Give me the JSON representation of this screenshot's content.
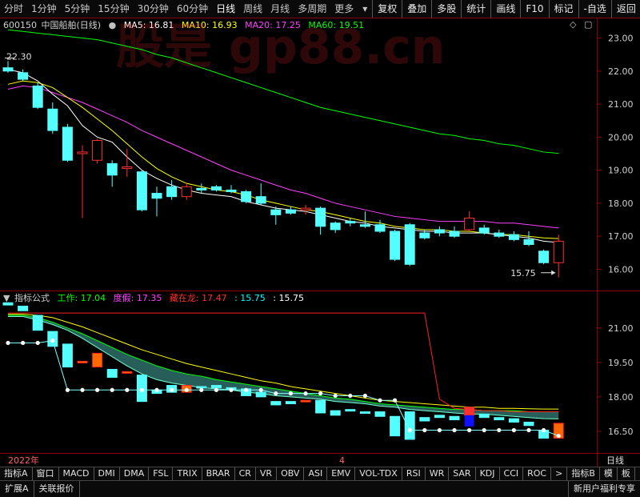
{
  "toolbar": {
    "period_tabs": [
      "分时",
      "1分钟",
      "5分钟",
      "15分钟",
      "30分钟",
      "60分钟",
      "日线",
      "周线",
      "月线",
      "多周期",
      "更多"
    ],
    "active_tab": "日线",
    "right_buttons": [
      "复权",
      "叠加",
      "多股",
      "统计",
      "画线",
      "F10",
      "标记",
      "-自选",
      "返回"
    ]
  },
  "watermark": "股是 gp88.cn",
  "main_legend": {
    "code": "600150",
    "name": "中国船舶(日线)",
    "ma5": "MA5: 16.81",
    "ma10": "MA10: 16.93",
    "ma20": "MA20: 17.25",
    "ma60": "MA60: 19.51",
    "colors": {
      "ma5": "#ffffff",
      "ma10": "#ffff00",
      "ma20": "#ff40ff",
      "ma60": "#00ff00"
    }
  },
  "main_labels": {
    "high_label": "22.30",
    "low_label": "15.75"
  },
  "main_axis": {
    "ticks": [
      "23.00",
      "22.00",
      "21.00",
      "20.00",
      "19.00",
      "18.00",
      "17.00",
      "16.00"
    ]
  },
  "ind_legend": {
    "title": "指标公式",
    "gz": "工作: 17.04",
    "dj": "度假: 17.35",
    "qz": "藏在龙: 17.47",
    "v1": ": 15.75",
    "v2": ": 15.75"
  },
  "ind_axis": {
    "ticks": [
      "21.00",
      "19.50",
      "18.00",
      "16.50"
    ]
  },
  "date_bar": {
    "year": "2022年",
    "month": "4",
    "period": "日线"
  },
  "indicator_tabs": [
    "指标A",
    "窗口",
    "MACD",
    "DMI",
    "DMA",
    "FSL",
    "TRIX",
    "BRAR",
    "CR",
    "VR",
    "OBV",
    "ASI",
    "EMV",
    "VOL-TDX",
    "RSI",
    "WR",
    "SAR",
    "KDJ",
    "CCI",
    "ROC",
    ">",
    "指标B",
    "模",
    "板"
  ],
  "bottom_bar": {
    "left": [
      "扩展A",
      "关联报价"
    ],
    "right": "新用户福利专享"
  },
  "chart_data": {
    "type": "candlestick",
    "candles": [
      {
        "o": 22.1,
        "c": 22.0,
        "h": 22.3,
        "l": 21.95
      },
      {
        "o": 21.95,
        "c": 21.75,
        "h": 22.05,
        "l": 21.7
      },
      {
        "o": 21.55,
        "c": 20.9,
        "h": 21.65,
        "l": 20.85
      },
      {
        "o": 20.85,
        "c": 20.2,
        "h": 21.05,
        "l": 20.1
      },
      {
        "o": 20.3,
        "c": 19.3,
        "h": 20.4,
        "l": 19.25
      },
      {
        "o": 19.5,
        "c": 19.55,
        "h": 19.75,
        "l": 17.55
      },
      {
        "o": 19.3,
        "c": 19.9,
        "h": 19.95,
        "l": 19.2
      },
      {
        "o": 19.2,
        "c": 18.85,
        "h": 19.3,
        "l": 18.5
      },
      {
        "o": 19.05,
        "c": 19.1,
        "h": 19.65,
        "l": 18.8
      },
      {
        "o": 18.95,
        "c": 17.8,
        "h": 19.0,
        "l": 17.75
      },
      {
        "o": 18.3,
        "c": 18.15,
        "h": 18.5,
        "l": 17.6
      },
      {
        "o": 18.5,
        "c": 18.2,
        "h": 18.7,
        "l": 18.1
      },
      {
        "o": 18.2,
        "c": 18.5,
        "h": 18.6,
        "l": 18.1
      },
      {
        "o": 18.45,
        "c": 18.4,
        "h": 18.6,
        "l": 18.3
      },
      {
        "o": 18.5,
        "c": 18.4,
        "h": 18.55,
        "l": 18.35
      },
      {
        "o": 18.4,
        "c": 18.35,
        "h": 18.55,
        "l": 18.3
      },
      {
        "o": 18.35,
        "c": 18.05,
        "h": 18.4,
        "l": 18.0
      },
      {
        "o": 18.2,
        "c": 18.0,
        "h": 18.6,
        "l": 17.95
      },
      {
        "o": 17.8,
        "c": 17.65,
        "h": 17.9,
        "l": 17.35
      },
      {
        "o": 17.8,
        "c": 17.7,
        "h": 17.9,
        "l": 17.65
      },
      {
        "o": 17.8,
        "c": 17.85,
        "h": 17.95,
        "l": 17.65
      },
      {
        "o": 17.85,
        "c": 17.3,
        "h": 17.9,
        "l": 17.05
      },
      {
        "o": 17.4,
        "c": 17.2,
        "h": 17.45,
        "l": 17.1
      },
      {
        "o": 17.45,
        "c": 17.4,
        "h": 17.55,
        "l": 17.3
      },
      {
        "o": 17.35,
        "c": 17.3,
        "h": 17.75,
        "l": 17.25
      },
      {
        "o": 17.35,
        "c": 17.15,
        "h": 17.5,
        "l": 17.1
      },
      {
        "o": 17.15,
        "c": 16.3,
        "h": 17.2,
        "l": 16.25
      },
      {
        "o": 17.35,
        "c": 16.15,
        "h": 17.4,
        "l": 16.1
      },
      {
        "o": 17.1,
        "c": 16.95,
        "h": 17.2,
        "l": 16.9
      },
      {
        "o": 17.2,
        "c": 17.1,
        "h": 17.3,
        "l": 17.0
      },
      {
        "o": 17.15,
        "c": 17.0,
        "h": 17.3,
        "l": 16.95
      },
      {
        "o": 17.2,
        "c": 17.55,
        "h": 17.75,
        "l": 17.15
      },
      {
        "o": 17.25,
        "c": 17.1,
        "h": 17.35,
        "l": 17.05
      },
      {
        "o": 17.1,
        "c": 17.0,
        "h": 17.2,
        "l": 16.95
      },
      {
        "o": 17.05,
        "c": 16.9,
        "h": 17.15,
        "l": 16.85
      },
      {
        "o": 16.9,
        "c": 16.75,
        "h": 17.15,
        "l": 16.7
      },
      {
        "o": 16.55,
        "c": 16.2,
        "h": 16.6,
        "l": 16.15
      },
      {
        "o": 16.2,
        "c": 16.85,
        "h": 17.05,
        "l": 15.75
      }
    ],
    "ma5": [
      22.05,
      21.95,
      21.7,
      21.3,
      20.95,
      20.35,
      20.0,
      19.85,
      19.4,
      19.0,
      18.75,
      18.55,
      18.4,
      18.3,
      18.25,
      18.2,
      18.05,
      17.95,
      17.85,
      17.8,
      17.75,
      17.65,
      17.55,
      17.45,
      17.4,
      17.3,
      17.25,
      17.2,
      17.15,
      17.15,
      17.1,
      17.1,
      17.1,
      17.05,
      17.0,
      16.95,
      16.85,
      16.81
    ],
    "ma10": [
      21.6,
      21.7,
      21.65,
      21.5,
      21.2,
      20.9,
      20.55,
      20.2,
      19.8,
      19.4,
      19.05,
      18.8,
      18.6,
      18.5,
      18.4,
      18.35,
      18.25,
      18.1,
      18.0,
      17.9,
      17.8,
      17.75,
      17.65,
      17.55,
      17.45,
      17.4,
      17.3,
      17.25,
      17.2,
      17.2,
      17.15,
      17.15,
      17.1,
      17.05,
      17.05,
      17.0,
      16.95,
      16.93
    ],
    "ma20": [
      21.45,
      21.55,
      21.5,
      21.35,
      21.2,
      21.05,
      20.85,
      20.65,
      20.45,
      20.2,
      20.0,
      19.8,
      19.6,
      19.4,
      19.2,
      19.0,
      18.85,
      18.7,
      18.55,
      18.4,
      18.3,
      18.15,
      18.0,
      17.9,
      17.8,
      17.7,
      17.6,
      17.55,
      17.5,
      17.45,
      17.45,
      17.45,
      17.45,
      17.4,
      17.4,
      17.35,
      17.3,
      17.25
    ],
    "ma60": [
      23.25,
      23.2,
      23.15,
      23.1,
      23.05,
      23.0,
      22.95,
      22.85,
      22.75,
      22.65,
      22.5,
      22.4,
      22.25,
      22.1,
      21.95,
      21.8,
      21.65,
      21.5,
      21.35,
      21.2,
      21.05,
      20.9,
      20.8,
      20.7,
      20.6,
      20.5,
      20.4,
      20.3,
      20.2,
      20.1,
      20.05,
      19.95,
      19.9,
      19.8,
      19.75,
      19.65,
      19.55,
      19.51
    ],
    "main_ylim": [
      15.6,
      23.4
    ],
    "ind_ylim": [
      15.8,
      21.9
    ],
    "indicator": {
      "support_dots": [
        20.35,
        20.35,
        20.35,
        20.45,
        18.3,
        18.3,
        18.3,
        18.3,
        18.3,
        18.3,
        18.3,
        18.3,
        18.3,
        18.3,
        18.3,
        18.3,
        18.3,
        18.3,
        18.15,
        18.15,
        18.15,
        18.15,
        18.05,
        18.05,
        18.05,
        17.85,
        17.85,
        16.55,
        16.55,
        16.55,
        16.55,
        16.55,
        16.55,
        16.55,
        16.55,
        16.55,
        16.55,
        16.3
      ],
      "red_step": [
        21.65,
        21.65,
        21.65,
        21.65,
        21.65,
        21.65,
        21.65,
        21.65,
        21.65,
        21.65,
        21.65,
        21.65,
        21.65,
        21.65,
        21.65,
        21.65,
        21.65,
        21.65,
        21.65,
        21.65,
        21.65,
        21.65,
        21.65,
        21.65,
        21.65,
        21.65,
        21.65,
        21.65,
        21.65,
        17.9,
        17.5,
        17.45,
        17.4,
        17.4,
        17.35,
        17.35,
        17.35,
        17.35
      ],
      "gz": [
        21.5,
        21.5,
        21.35,
        21.15,
        20.9,
        20.55,
        20.15,
        19.75,
        19.35,
        19.0,
        18.75,
        18.6,
        18.5,
        18.4,
        18.35,
        18.3,
        18.2,
        18.15,
        18.05,
        18.0,
        17.95,
        17.9,
        17.8,
        17.75,
        17.7,
        17.6,
        17.55,
        17.45,
        17.4,
        17.35,
        17.3,
        17.25,
        17.25,
        17.2,
        17.15,
        17.1,
        17.05,
        17.04
      ],
      "dj": [
        21.55,
        21.55,
        21.45,
        21.25,
        21.0,
        20.75,
        20.45,
        20.15,
        19.85,
        19.6,
        19.35,
        19.15,
        19.0,
        18.9,
        18.75,
        18.65,
        18.55,
        18.45,
        18.35,
        18.25,
        18.15,
        18.05,
        17.95,
        17.9,
        17.8,
        17.7,
        17.65,
        17.6,
        17.55,
        17.5,
        17.45,
        17.45,
        17.4,
        17.4,
        17.4,
        17.35,
        17.35,
        17.35
      ],
      "qz": [
        21.6,
        21.6,
        21.55,
        21.45,
        21.25,
        21.05,
        20.8,
        20.55,
        20.3,
        20.05,
        19.85,
        19.65,
        19.45,
        19.3,
        19.15,
        19.0,
        18.85,
        18.7,
        18.6,
        18.45,
        18.35,
        18.25,
        18.15,
        18.05,
        17.95,
        17.85,
        17.8,
        17.75,
        17.7,
        17.65,
        17.6,
        17.55,
        17.55,
        17.5,
        17.5,
        17.48,
        17.47,
        17.47
      ]
    }
  }
}
